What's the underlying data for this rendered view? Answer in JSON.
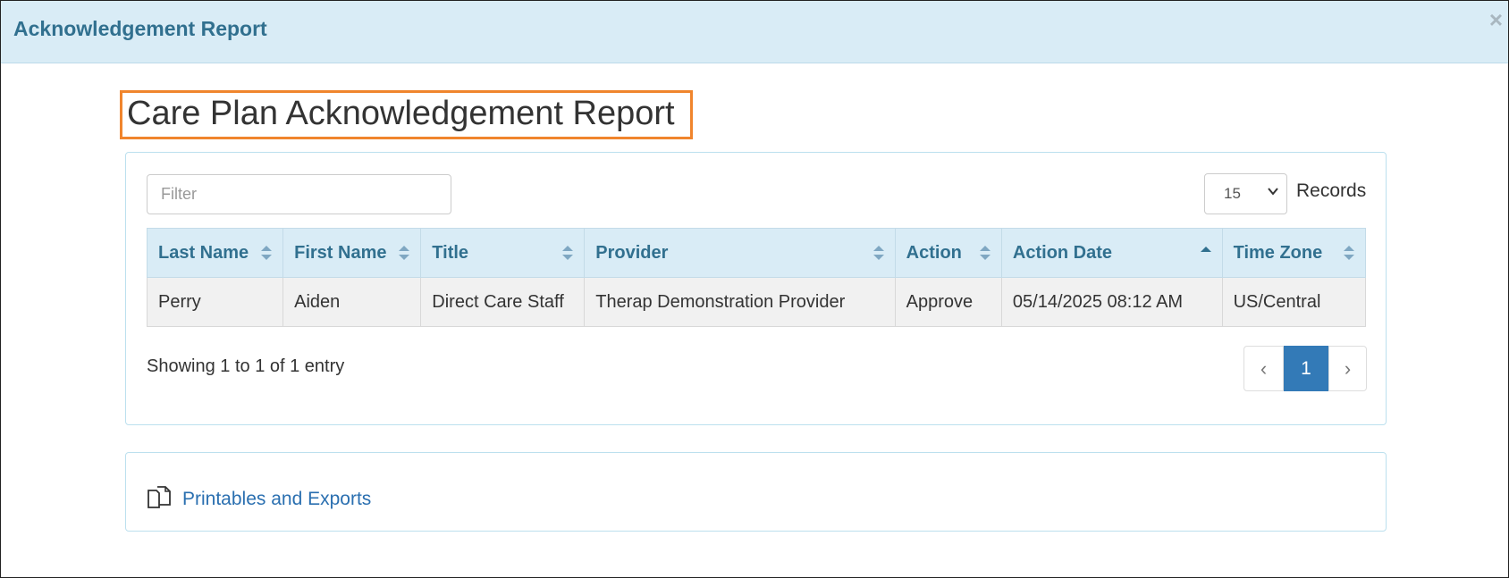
{
  "modal": {
    "title": "Acknowledgement Report",
    "close_label": "×"
  },
  "page": {
    "title": "Care Plan Acknowledgement Report",
    "highlight_color": "#f0852d"
  },
  "toolbar": {
    "filter_placeholder": "Filter",
    "records_value": "15",
    "records_label": "Records"
  },
  "table": {
    "columns": [
      "Last Name",
      "First Name",
      "Title",
      "Provider",
      "Action",
      "Action Date",
      "Time Zone"
    ],
    "sorted_column": "Action Date",
    "sort_direction": "ascending",
    "rows": [
      [
        "Perry",
        "Aiden",
        "Direct Care Staff",
        "Therap Demonstration Provider",
        "Approve",
        "05/14/2025 08:12 AM",
        "US/Central"
      ]
    ]
  },
  "footer": {
    "showing": "Showing 1 to 1 of 1 entry",
    "pager": {
      "prev": "‹",
      "current": "1",
      "next": "›"
    }
  },
  "exports": {
    "icon": "copy-documents-icon",
    "label": "Printables and Exports"
  },
  "colors": {
    "header_bg": "#d9ecf6",
    "header_text": "#31708f",
    "primary": "#337ab7",
    "link": "#2a6fb0"
  }
}
